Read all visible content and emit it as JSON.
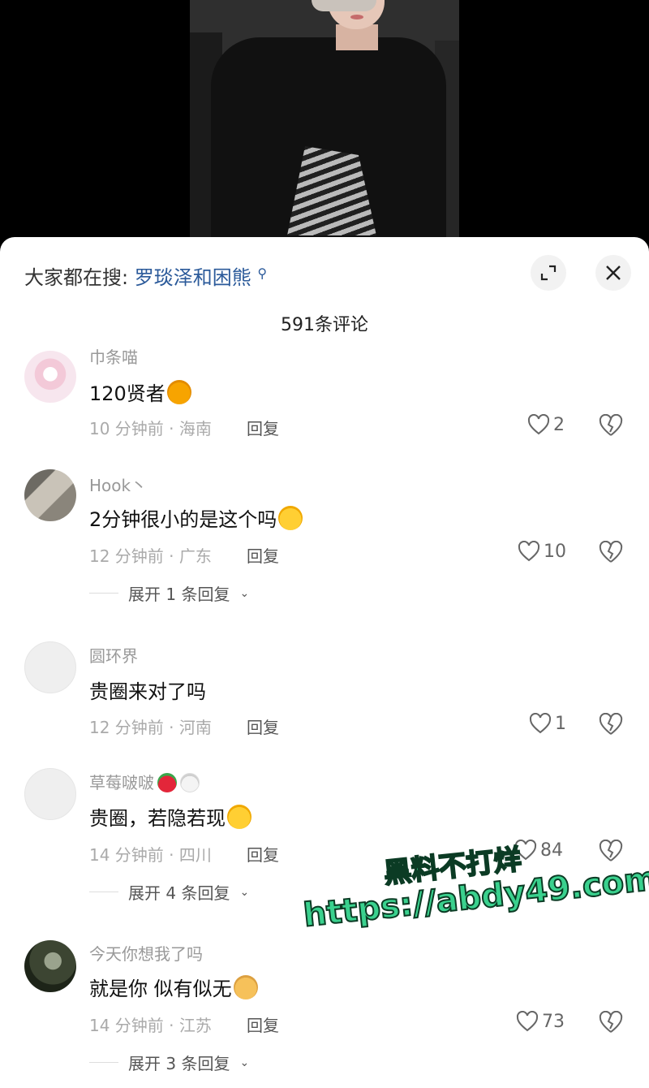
{
  "search": {
    "label": "大家都在搜:",
    "term": "罗琰泽和困熊",
    "term_icon": "search-icon"
  },
  "header": {
    "comment_count": "591条评论",
    "expand_icon": "expand-icon",
    "close_icon": "close-icon"
  },
  "comments": [
    {
      "username": "巾条喵",
      "text": "120贤者",
      "emoji": "yum-emoji",
      "time": "10 分钟前 · 海南",
      "reply_label": "回复",
      "likes": "2"
    },
    {
      "username": "Hook丶",
      "text": "2分钟很小的是这个吗",
      "emoji": "thinking-emoji",
      "time": "12 分钟前 · 广东",
      "reply_label": "回复",
      "likes": "10",
      "expand_label": "展开 1 条回复"
    },
    {
      "username": "圆环界",
      "text": "贵圈来对了吗",
      "time": "12 分钟前 · 河南",
      "reply_label": "回复",
      "likes": "1"
    },
    {
      "username": "草莓啵啵",
      "username_emojis": [
        "strawberry-emoji",
        "rabbit-emoji"
      ],
      "text": "贵圈，若隐若现",
      "emoji": "laughing-crying-emoji",
      "time": "14 分钟前 · 四川",
      "reply_label": "回复",
      "likes": "84",
      "expand_label": "展开 4 条回复"
    },
    {
      "username": "今天你想我了吗",
      "text": "就是你 似有似无",
      "emoji": "dog-face-emoji",
      "time": "14 分钟前 · 江苏",
      "reply_label": "回复",
      "likes": "73",
      "expand_label": "展开 3 条回复"
    }
  ],
  "watermark": {
    "line1": "黑料不打烊",
    "line2": "https://abdy49.com"
  }
}
